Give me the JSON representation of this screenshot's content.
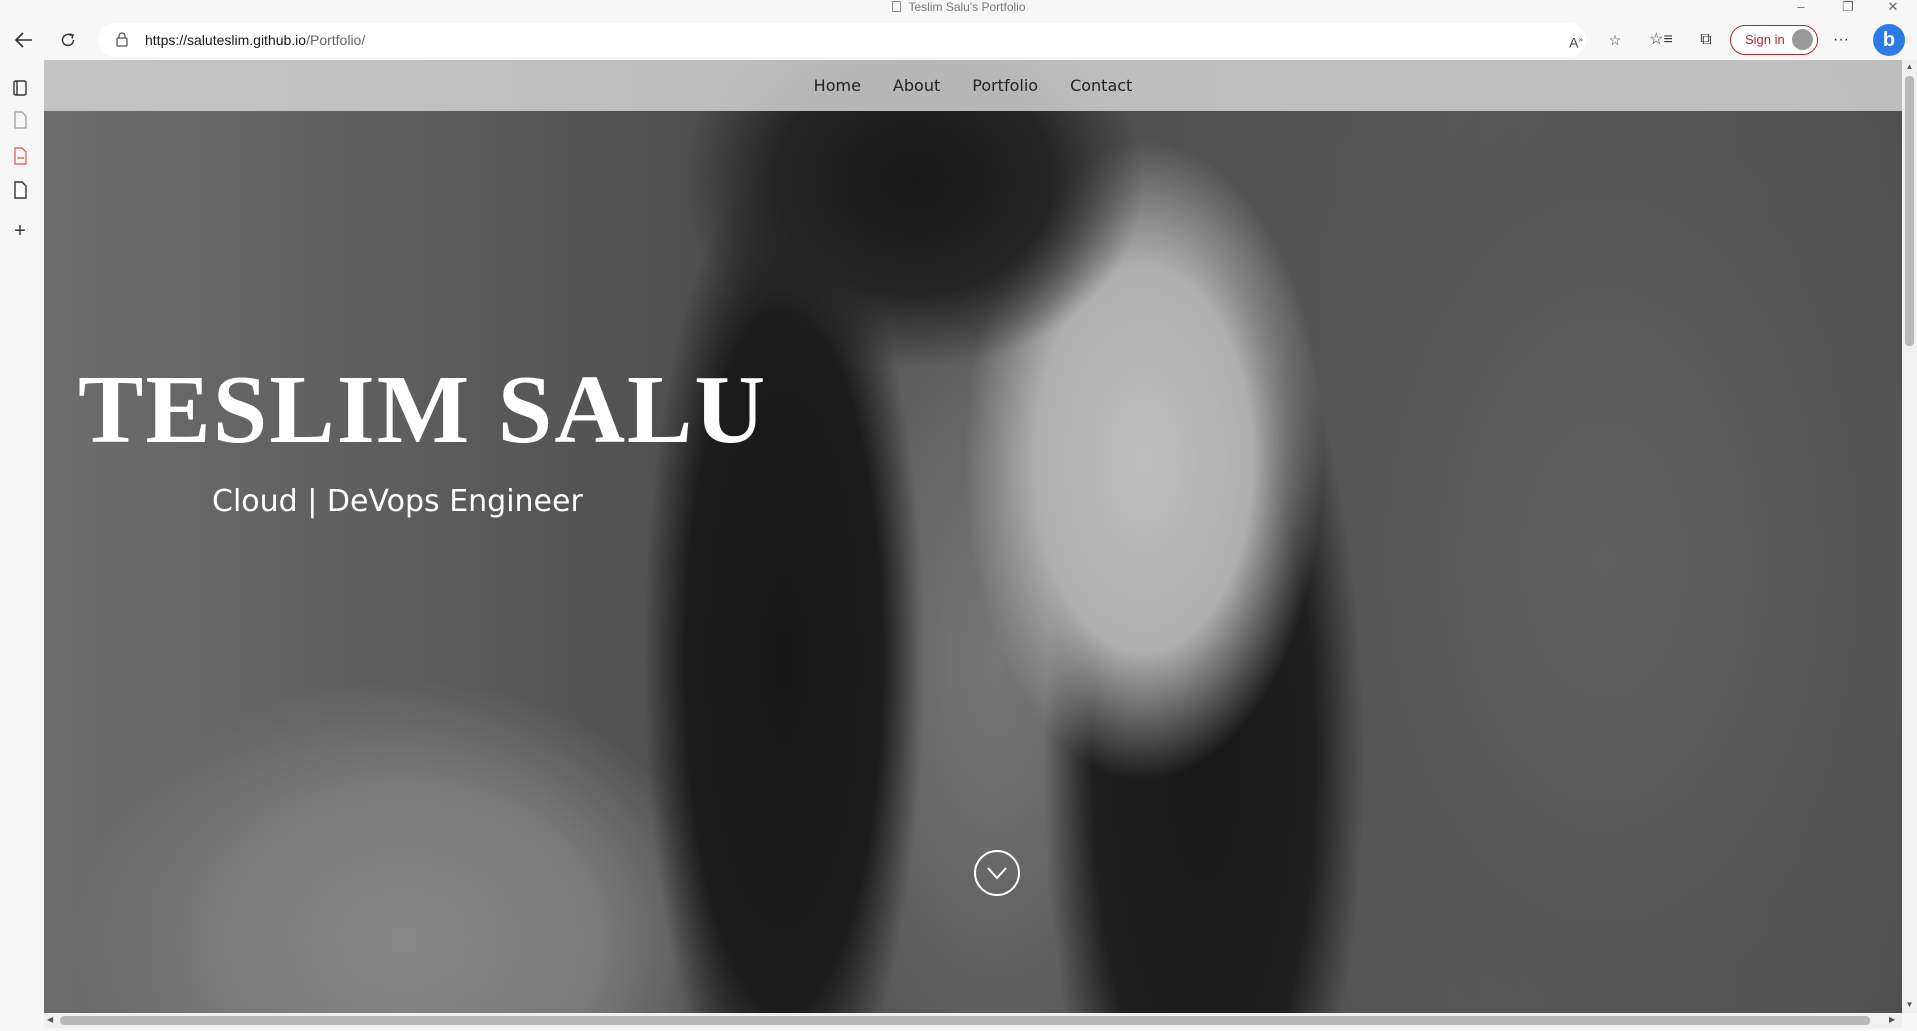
{
  "window": {
    "title": "Teslim Salu's Portfolio"
  },
  "browser": {
    "url_host": "https://saluteslim.github.io",
    "url_path": "/Portfolio/",
    "sign_in_label": "Sign in"
  },
  "site": {
    "nav": [
      {
        "label": "Home"
      },
      {
        "label": "About"
      },
      {
        "label": "Portfolio"
      },
      {
        "label": "Contact"
      }
    ],
    "hero": {
      "name": "TESLIM SALU",
      "role": "Cloud | DeVops Engineer"
    }
  },
  "icons": {
    "back": "back-arrow-icon",
    "refresh": "refresh-icon",
    "lock": "lock-icon",
    "read_aloud": "read-aloud-icon",
    "add_favorite": "add-favorite-icon",
    "favorites": "favorites-icon",
    "collections": "collections-icon",
    "more": "more-icon",
    "copilot": "bing-copilot-icon",
    "scroll_down": "chevron-down-circle-icon"
  }
}
